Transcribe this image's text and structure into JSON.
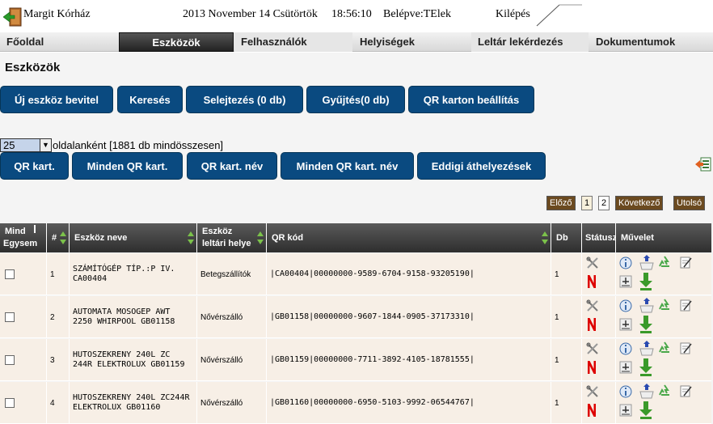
{
  "header": {
    "user": "Margit Kórház",
    "datetime": "2013 November 14 Csütörtök",
    "time": "18:56:10",
    "login": "Belépve:TElek",
    "logout": "Kilépés"
  },
  "nav": [
    {
      "label": "Főoldal"
    },
    {
      "label": "Eszközök"
    },
    {
      "label": "Felhasználók"
    },
    {
      "label": "Helyiségek"
    },
    {
      "label": "Leltár lekérdezés"
    },
    {
      "label": "Dokumentumok"
    }
  ],
  "page": {
    "title": "Eszközök",
    "buttons_row1": [
      "Új eszköz bevitel",
      "Keresés",
      "Selejtezés (0 db)",
      "Gyűjtés(0 db)",
      "QR karton beállítás"
    ],
    "per_page_value": "25",
    "per_page_label": "oldalanként [1881 db mindösszesen]",
    "buttons_row2": [
      "QR kart.",
      "Minden QR kart.",
      "QR kart. név",
      "Minden QR kart. név",
      "Eddigi áthelyezések"
    ]
  },
  "pagination": {
    "prev": "Előző",
    "pages": [
      "1",
      "2"
    ],
    "current": "1",
    "next": "Következő",
    "last": "Utolsó"
  },
  "table": {
    "headers": {
      "select_top": "Mind",
      "select_bottom": "Egysem",
      "num": "#",
      "name": "Eszköz neve",
      "location_top": "Eszköz",
      "location_bottom": "leltári helye",
      "qr": "QR kód",
      "db": "Db",
      "status": "Státusz",
      "action": "Művelet"
    },
    "rows": [
      {
        "num": "1",
        "name": "SZÁMÍTÓGÉP TÍP.:P IV. CA00404",
        "location": "Betegszállítók",
        "qr": "|CA00404|00000000-9589-6704-9158-93205190|",
        "db": "1"
      },
      {
        "num": "2",
        "name": "AUTOMATA MOSOGEP AWT 2250 WHIRPOOL GB01158",
        "location": "Nővérszálló",
        "qr": "|GB01158|00000000-9607-1844-0905-37173310|",
        "db": "1"
      },
      {
        "num": "3",
        "name": "HUTOSZEKRENY 240L ZC 244R ELEKTROLUX GB01159",
        "location": "Nővérszálló",
        "qr": "|GB01159|00000000-7711-3892-4105-18781555|",
        "db": "1"
      },
      {
        "num": "4",
        "name": "HUTOSZEKRENY 240L ZC244R ELEKTROLUX GB01160",
        "location": "Nővérszálló",
        "qr": "|GB01160|00000000-6950-5103-9992-06544767|",
        "db": "1"
      }
    ]
  },
  "colors": {
    "button": "#0a4a80",
    "row_bg": "#f7efe6",
    "header_bg": "#3a3a3a",
    "nav_active": "#2a2a2a"
  }
}
